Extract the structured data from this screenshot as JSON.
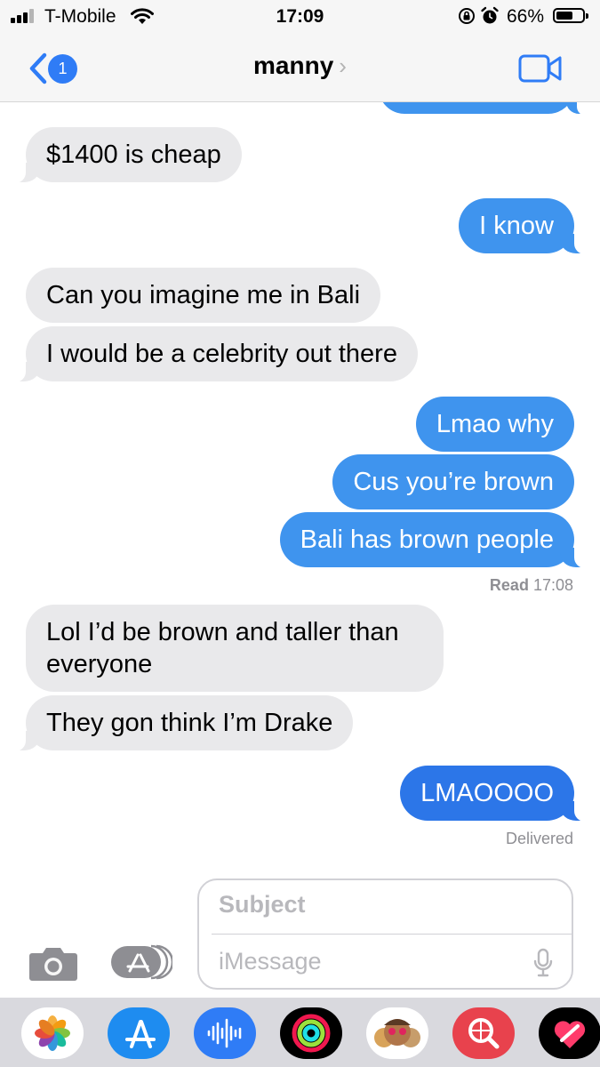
{
  "status_bar": {
    "carrier": "T-Mobile",
    "time": "17:09",
    "battery_percent": "66%",
    "battery_level": 0.66
  },
  "header": {
    "back_badge": "1",
    "contact_name": "manny",
    "chevron": "›"
  },
  "messages": [
    {
      "from": "them",
      "text": "$1400 is cheap"
    },
    {
      "from": "me",
      "text": "I know"
    },
    {
      "from": "them",
      "text": "Can you imagine me in Bali"
    },
    {
      "from": "them",
      "text": "I would be a celebrity out there"
    },
    {
      "from": "me",
      "text": "Lmao why"
    },
    {
      "from": "me",
      "text": "Cus you’re brown"
    },
    {
      "from": "me",
      "text": "Bali has brown people"
    },
    {
      "from": "them",
      "text": "Lol I’d be brown and taller than everyone"
    },
    {
      "from": "them",
      "text": "They gon think I’m Drake"
    },
    {
      "from": "me",
      "text": "LMAOOOO"
    }
  ],
  "receipts": {
    "read_label": "Read",
    "read_time": "17:08",
    "delivered": "Delivered"
  },
  "compose": {
    "subject_placeholder": "Subject",
    "message_placeholder": "iMessage"
  },
  "app_drawer": [
    "photos-app",
    "app-store-app",
    "audio-message-app",
    "activity-app",
    "memoji-app",
    "images-search-app",
    "digital-touch-app"
  ],
  "colors": {
    "incoming_bubble": "#e9e9eb",
    "outgoing_bubble": "#3f94ee",
    "ios_blue": "#2f7cf6",
    "header_bg": "#f6f6f6",
    "drawer_bg": "#d9d9de"
  }
}
